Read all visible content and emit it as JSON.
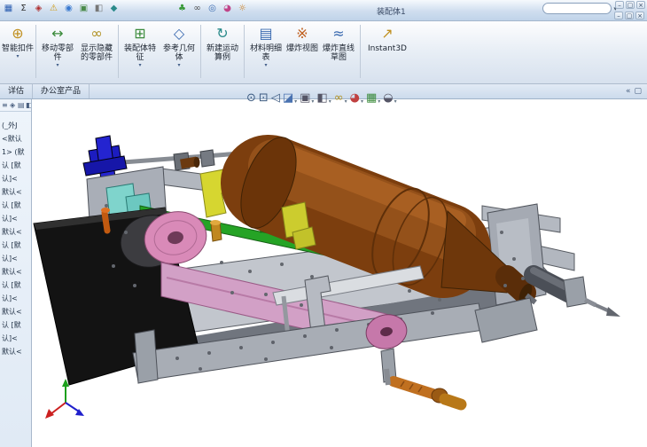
{
  "window": {
    "title": "装配体1",
    "search_value": "",
    "controls": [
      "–",
      "▢",
      "×"
    ],
    "doc_controls": [
      "–",
      "▢",
      "×"
    ]
  },
  "ui": {
    "dropdown_glyph": "▾"
  },
  "quick_access": {
    "icons": [
      {
        "name": "sketch-grid-icon",
        "glyph": "▦"
      },
      {
        "name": "measure-icon",
        "glyph": "Σ"
      },
      {
        "name": "rebuild-icon",
        "glyph": "◈"
      },
      {
        "name": "warning-icon",
        "glyph": "⚠"
      },
      {
        "name": "material-sphere-icon",
        "glyph": "◉"
      },
      {
        "name": "view-cube-icon",
        "glyph": "▣"
      },
      {
        "name": "section-icon",
        "glyph": "◧"
      },
      {
        "name": "options-icon",
        "glyph": "◆"
      },
      {
        "name": "leaf-icon",
        "glyph": "♣"
      },
      {
        "name": "glasses-icon",
        "glyph": "∞"
      },
      {
        "name": "target-icon",
        "glyph": "◎"
      },
      {
        "name": "appearance-icon",
        "glyph": "◕"
      },
      {
        "name": "scene-icon",
        "glyph": "☼"
      }
    ]
  },
  "ribbon": {
    "buttons": [
      {
        "label": "智能扣件",
        "icon": "⊕"
      },
      {
        "label": "移动零部件",
        "icon": "↔"
      },
      {
        "label": "显示隐藏的零部件",
        "icon": "∞"
      },
      {
        "label": "装配体特征",
        "icon": "⊞"
      },
      {
        "label": "参考几何体",
        "icon": "◇"
      },
      {
        "label": "新建运动算例",
        "icon": "↻"
      },
      {
        "label": "材料明细表",
        "icon": "▤"
      },
      {
        "label": "爆炸视图",
        "icon": "※"
      },
      {
        "label": "爆炸直线草图",
        "icon": "≈"
      },
      {
        "label": "Instant3D",
        "icon": "↗"
      }
    ]
  },
  "tabs": [
    {
      "label": "详估"
    },
    {
      "label": "办公室产品"
    }
  ],
  "canvas_corner": {
    "icons": [
      {
        "name": "collapse-pane-icon",
        "glyph": "«"
      },
      {
        "name": "task-pane-icon",
        "glyph": "▢"
      }
    ]
  },
  "viewport_toolbar": {
    "icons": [
      {
        "name": "zoom-fit-icon",
        "glyph": "⊙"
      },
      {
        "name": "zoom-area-icon",
        "glyph": "⊡"
      },
      {
        "name": "previous-view-icon",
        "glyph": "◁"
      },
      {
        "name": "section-view-icon",
        "glyph": "◪"
      },
      {
        "name": "view-orientation-icon",
        "glyph": "▣"
      },
      {
        "name": "display-style-icon",
        "glyph": "◧"
      },
      {
        "name": "hide-show-items-icon",
        "glyph": "∞"
      },
      {
        "name": "edit-appearance-icon",
        "glyph": "◕"
      },
      {
        "name": "apply-scene-icon",
        "glyph": "▦"
      },
      {
        "name": "view-settings-icon",
        "glyph": "◒"
      }
    ]
  },
  "feature_panel": {
    "header_icons": [
      {
        "name": "feature-manager-icon",
        "glyph": "≡"
      },
      {
        "name": "property-manager-icon",
        "glyph": "◈"
      },
      {
        "name": "configuration-manager-icon",
        "glyph": "▤"
      },
      {
        "name": "display-manager-icon",
        "glyph": "◧"
      }
    ],
    "items": [
      "(_外J",
      "<默认",
      "1> (默",
      "认 [默",
      "认]<",
      "默认<",
      "认 [默",
      "认]<",
      "默认<",
      "认 [默",
      "认]<",
      "默认<",
      "认 [默",
      "认]<",
      "默认<",
      "认 [默",
      "认]<",
      "默认<"
    ]
  },
  "model": {
    "parts": {
      "frame": {
        "color": "#c2c6cd"
      },
      "motor": {
        "color": "#7c3e0e"
      },
      "black_plate": {
        "color": "#131313"
      },
      "pulley_large": {
        "color": "#d98ab8"
      },
      "pulley_small": {
        "color": "#c678aa"
      },
      "belt": {
        "color": "#d2a0c6"
      },
      "rail": {
        "color": "#25a325"
      },
      "slider": {
        "color": "#7fd4cc"
      },
      "bracket_blue": {
        "color": "#1c1cc0"
      },
      "cam_yellow": {
        "color": "#d6d630"
      },
      "screw": {
        "color": "#c07020"
      }
    },
    "triad": {
      "x_color": "#cc2020",
      "y_color": "#1da01d",
      "z_color": "#2020cc"
    }
  }
}
